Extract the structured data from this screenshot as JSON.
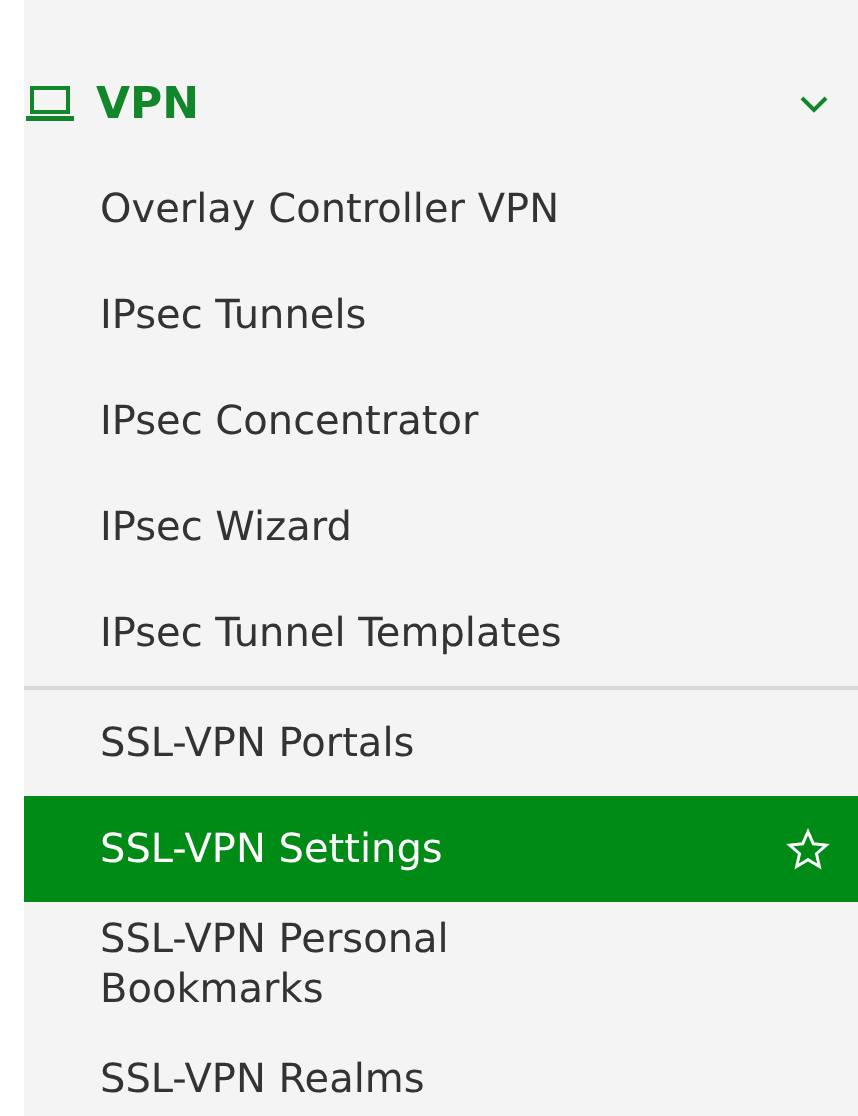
{
  "menu": {
    "title": "VPN",
    "expanded": true,
    "groups": [
      [
        {
          "label": "Overlay Controller VPN",
          "selected": false
        },
        {
          "label": "IPsec Tunnels",
          "selected": false
        },
        {
          "label": "IPsec Concentrator",
          "selected": false
        },
        {
          "label": "IPsec Wizard",
          "selected": false
        },
        {
          "label": "IPsec Tunnel Templates",
          "selected": false
        }
      ],
      [
        {
          "label": "SSL-VPN Portals",
          "selected": false
        },
        {
          "label": "SSL-VPN Settings",
          "selected": true
        },
        {
          "label": "SSL-VPN Personal Bookmarks",
          "selected": false
        },
        {
          "label": "SSL-VPN Realms",
          "selected": false
        }
      ]
    ]
  }
}
